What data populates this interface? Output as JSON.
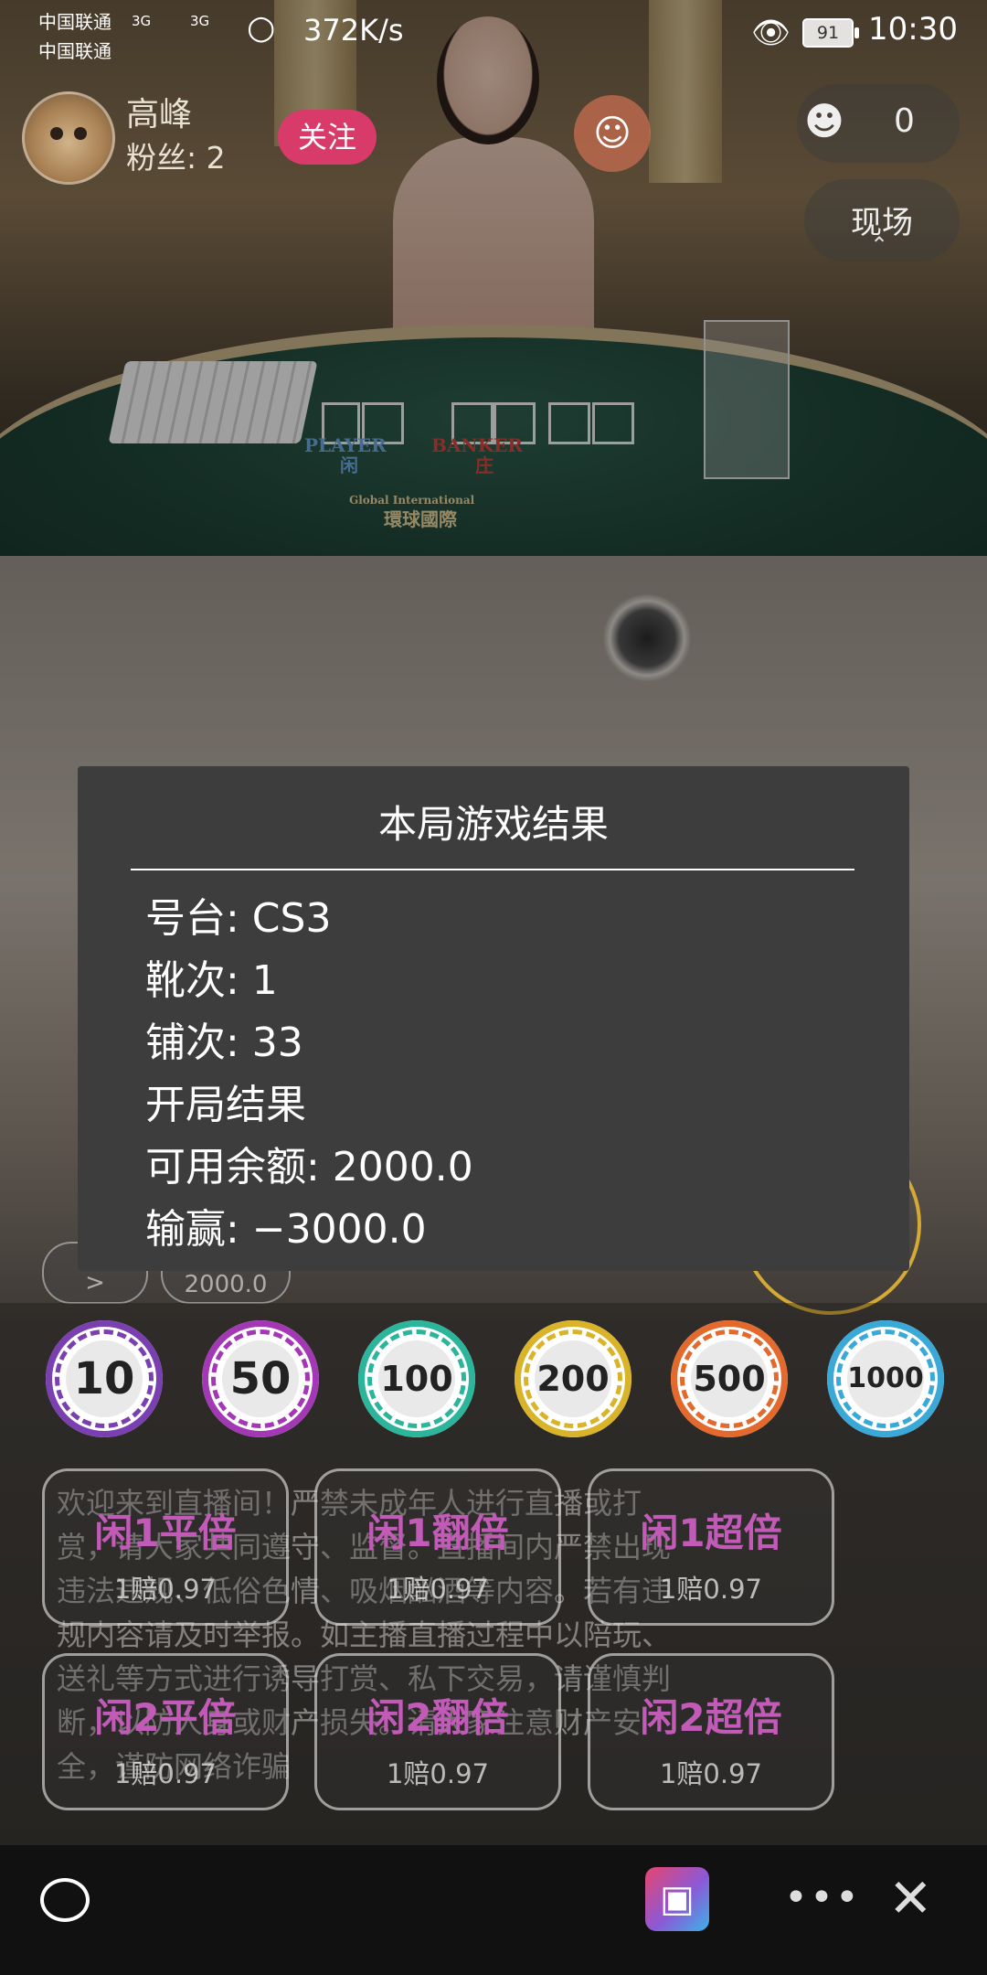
{
  "status_bar": {
    "carrier_1": "中国联通",
    "carrier_2": "中国联通",
    "signal_1": "3G",
    "signal_2": "3G",
    "net_speed": "372K/s",
    "battery": "91",
    "time": "10:30"
  },
  "host": {
    "name": "高峰",
    "fans": "粉丝: 2",
    "follow_label": "关注"
  },
  "viewers": {
    "count": "0"
  },
  "scene_label": "现场",
  "table_felt": {
    "player": "PLAYER",
    "player_cn": "闲",
    "banker": "BANKER",
    "banker_cn": "庄",
    "brand_en": "Global International",
    "brand_cn": "環球國際"
  },
  "dialog": {
    "title": "本局游戏结果",
    "table_no": "号台: CS3",
    "shoe_no": "靴次: 1",
    "round_no": "铺次: 33",
    "result_label": "开局结果",
    "balance": "可用余额: 2000.0",
    "win_loss": "输赢: −3000.0"
  },
  "partial": {
    "left_pill": ">",
    "balance_pill": "2000.0"
  },
  "chips": [
    {
      "value": "10",
      "color": "#7a3fb0"
    },
    {
      "value": "50",
      "color": "#a338b5"
    },
    {
      "value": "100",
      "color": "#2bb59a"
    },
    {
      "value": "200",
      "color": "#d9b42a"
    },
    {
      "value": "500",
      "color": "#e36a2c"
    },
    {
      "value": "1000",
      "color": "#3aa9d8"
    }
  ],
  "notice": "欢迎来到直播间！严禁未成年人进行直播或打赏，请大家共同遵守、监督。直播间内严禁出现违法违规、低俗色情、吸烟酗酒等内容。若有违规内容请及时举报。如主播直播过程中以陪玩、送礼等方式进行诱导打赏、私下交易，请谨慎判断，以防人身或财产损失。请大家注意财产安全，谨防网络诈骗",
  "bets": [
    {
      "title": "闲1平倍",
      "odds": "1赔0.97"
    },
    {
      "title": "闲1翻倍",
      "odds": "1赔0.97"
    },
    {
      "title": "闲1超倍",
      "odds": "1赔0.97"
    },
    {
      "title": "闲2平倍",
      "odds": "1赔0.97"
    },
    {
      "title": "闲2翻倍",
      "odds": "1赔0.97"
    },
    {
      "title": "闲2超倍",
      "odds": "1赔0.97"
    }
  ],
  "icons": {
    "wifi": "wifi-icon",
    "eye": "eye-icon",
    "viewers": "people-icon",
    "user": "user-icon",
    "chat": "chat-icon",
    "gift": "gift-icon",
    "more": "more-icon",
    "close": "close-icon"
  }
}
